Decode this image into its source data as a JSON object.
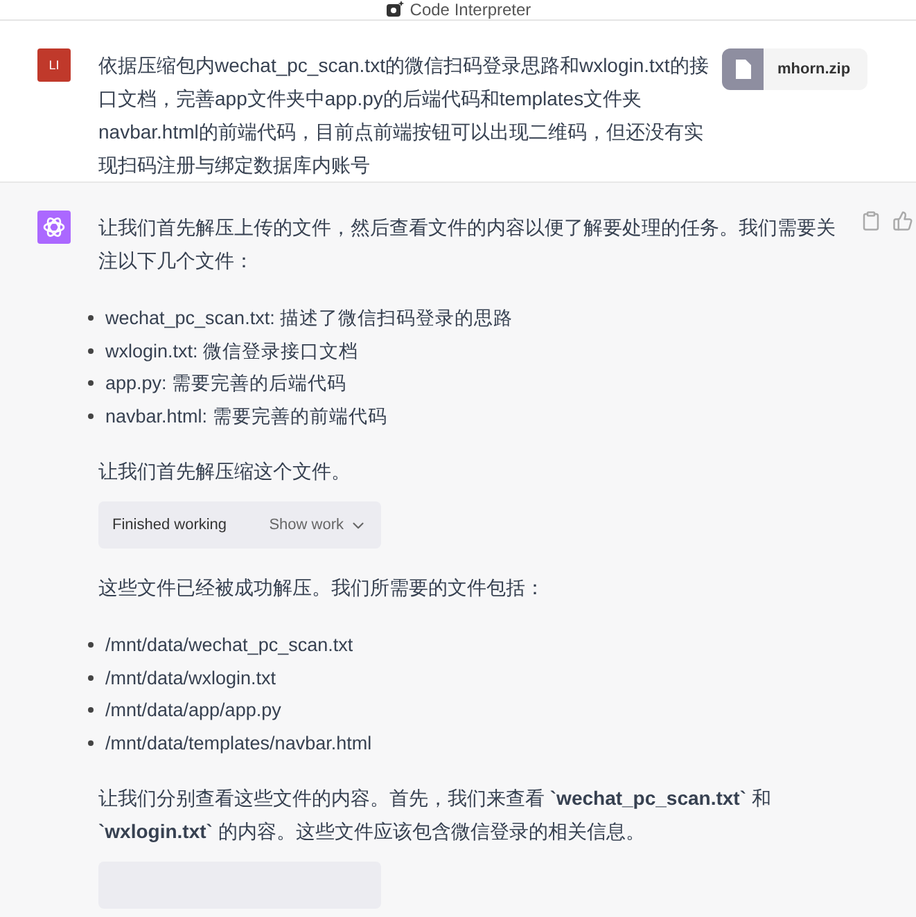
{
  "header": {
    "title": "Code Interpreter"
  },
  "user_message": {
    "avatar": "LI",
    "text": "依据压缩包内wechat_pc_scan.txt的微信扫码登录思路和wxlogin.txt的接口文档，完善app文件夹中app.py的后端代码和templates文件夹navbar.html的前端代码，目前点前端按钮可以出现二维码，但还没有实现扫码注册与绑定数据库内账号",
    "attachment": {
      "name": "mhorn.zip"
    }
  },
  "assistant_message": {
    "blocks": [
      {
        "kind": "paragraph",
        "text": "让我们首先解压上传的文件，然后查看文件的内容以便了解要处理的任务。我们需要关注以下几个文件："
      },
      {
        "kind": "list",
        "items": [
          "wechat_pc_scan.txt: 描述了微信扫码登录的思路",
          "wxlogin.txt: 微信登录接口文档",
          "app.py: 需要完善的后端代码",
          "navbar.html: 需要完善的前端代码"
        ]
      },
      {
        "kind": "paragraph",
        "text": "让我们首先解压缩这个文件。"
      },
      {
        "kind": "work",
        "status": "Finished working",
        "toggle": "Show work"
      },
      {
        "kind": "paragraph",
        "text": "这些文件已经被成功解压。我们所需要的文件包括："
      },
      {
        "kind": "list",
        "items": [
          "/mnt/data/wechat_pc_scan.txt",
          "/mnt/data/wxlogin.txt",
          "/mnt/data/app/app.py",
          "/mnt/data/templates/navbar.html"
        ]
      },
      {
        "kind": "paragraph",
        "text": "让我们分别查看这些文件的内容。首先，我们来查看 **`wechat_pc_scan.txt`** 和 **`wxlogin.txt`** 的内容。这些文件应该包含微信登录的相关信息。"
      },
      {
        "kind": "work"
      }
    ]
  }
}
